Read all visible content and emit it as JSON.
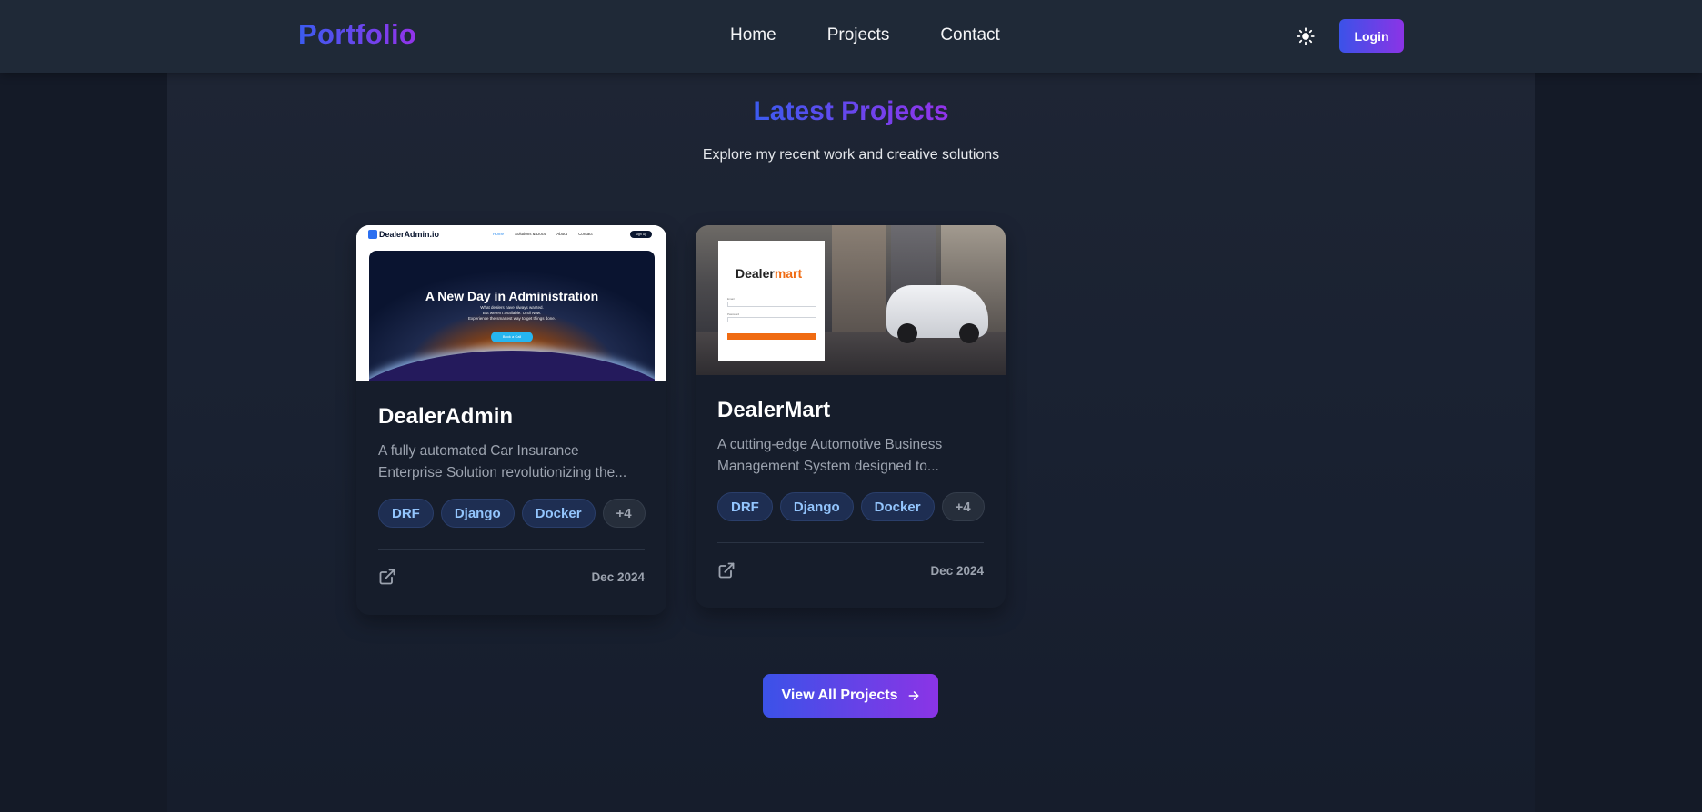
{
  "navbar": {
    "brand": "Portfolio",
    "links": [
      "Home",
      "Projects",
      "Contact"
    ],
    "theme_icon": "sun-icon",
    "login_label": "Login"
  },
  "section": {
    "title": "Latest Projects",
    "subtitle": "Explore my recent work and creative solutions"
  },
  "projects": [
    {
      "title": "DealerAdmin",
      "description": "A fully automated Car Insurance Enterprise Solution revolutionizing the...",
      "tags": [
        "DRF",
        "Django",
        "Docker",
        "+4"
      ],
      "date": "Dec 2024",
      "link_icon": "external-link-icon",
      "thumbnail": {
        "logo": "DealerAdmin.io",
        "nav": [
          "Home",
          "Solutions & Docs",
          "About",
          "Contact"
        ],
        "cta": "Sign Up",
        "hero_title": "A New Day in Administration",
        "hero_sub": [
          "What dealers have always wanted.",
          "But weren't available. Until Now.",
          "Experience the smartest way to get things done."
        ],
        "hero_button": "Book a Call"
      }
    },
    {
      "title": "DealerMart",
      "description": "A cutting-edge Automotive Business Management System designed to...",
      "tags": [
        "DRF",
        "Django",
        "Docker",
        "+4"
      ],
      "date": "Dec 2024",
      "link_icon": "external-link-icon",
      "thumbnail": {
        "logo_a": "Dealer",
        "logo_b": "mart"
      }
    }
  ],
  "view_all": {
    "label": "View All Projects",
    "icon": "arrow-right-icon"
  },
  "colors": {
    "accent_start": "#3b52e8",
    "accent_end": "#8b34e6",
    "nav_bg": "#1f2937",
    "page_bg": "#141a27",
    "card_bg": "#161d2b",
    "tag_text": "#93c5fd"
  }
}
